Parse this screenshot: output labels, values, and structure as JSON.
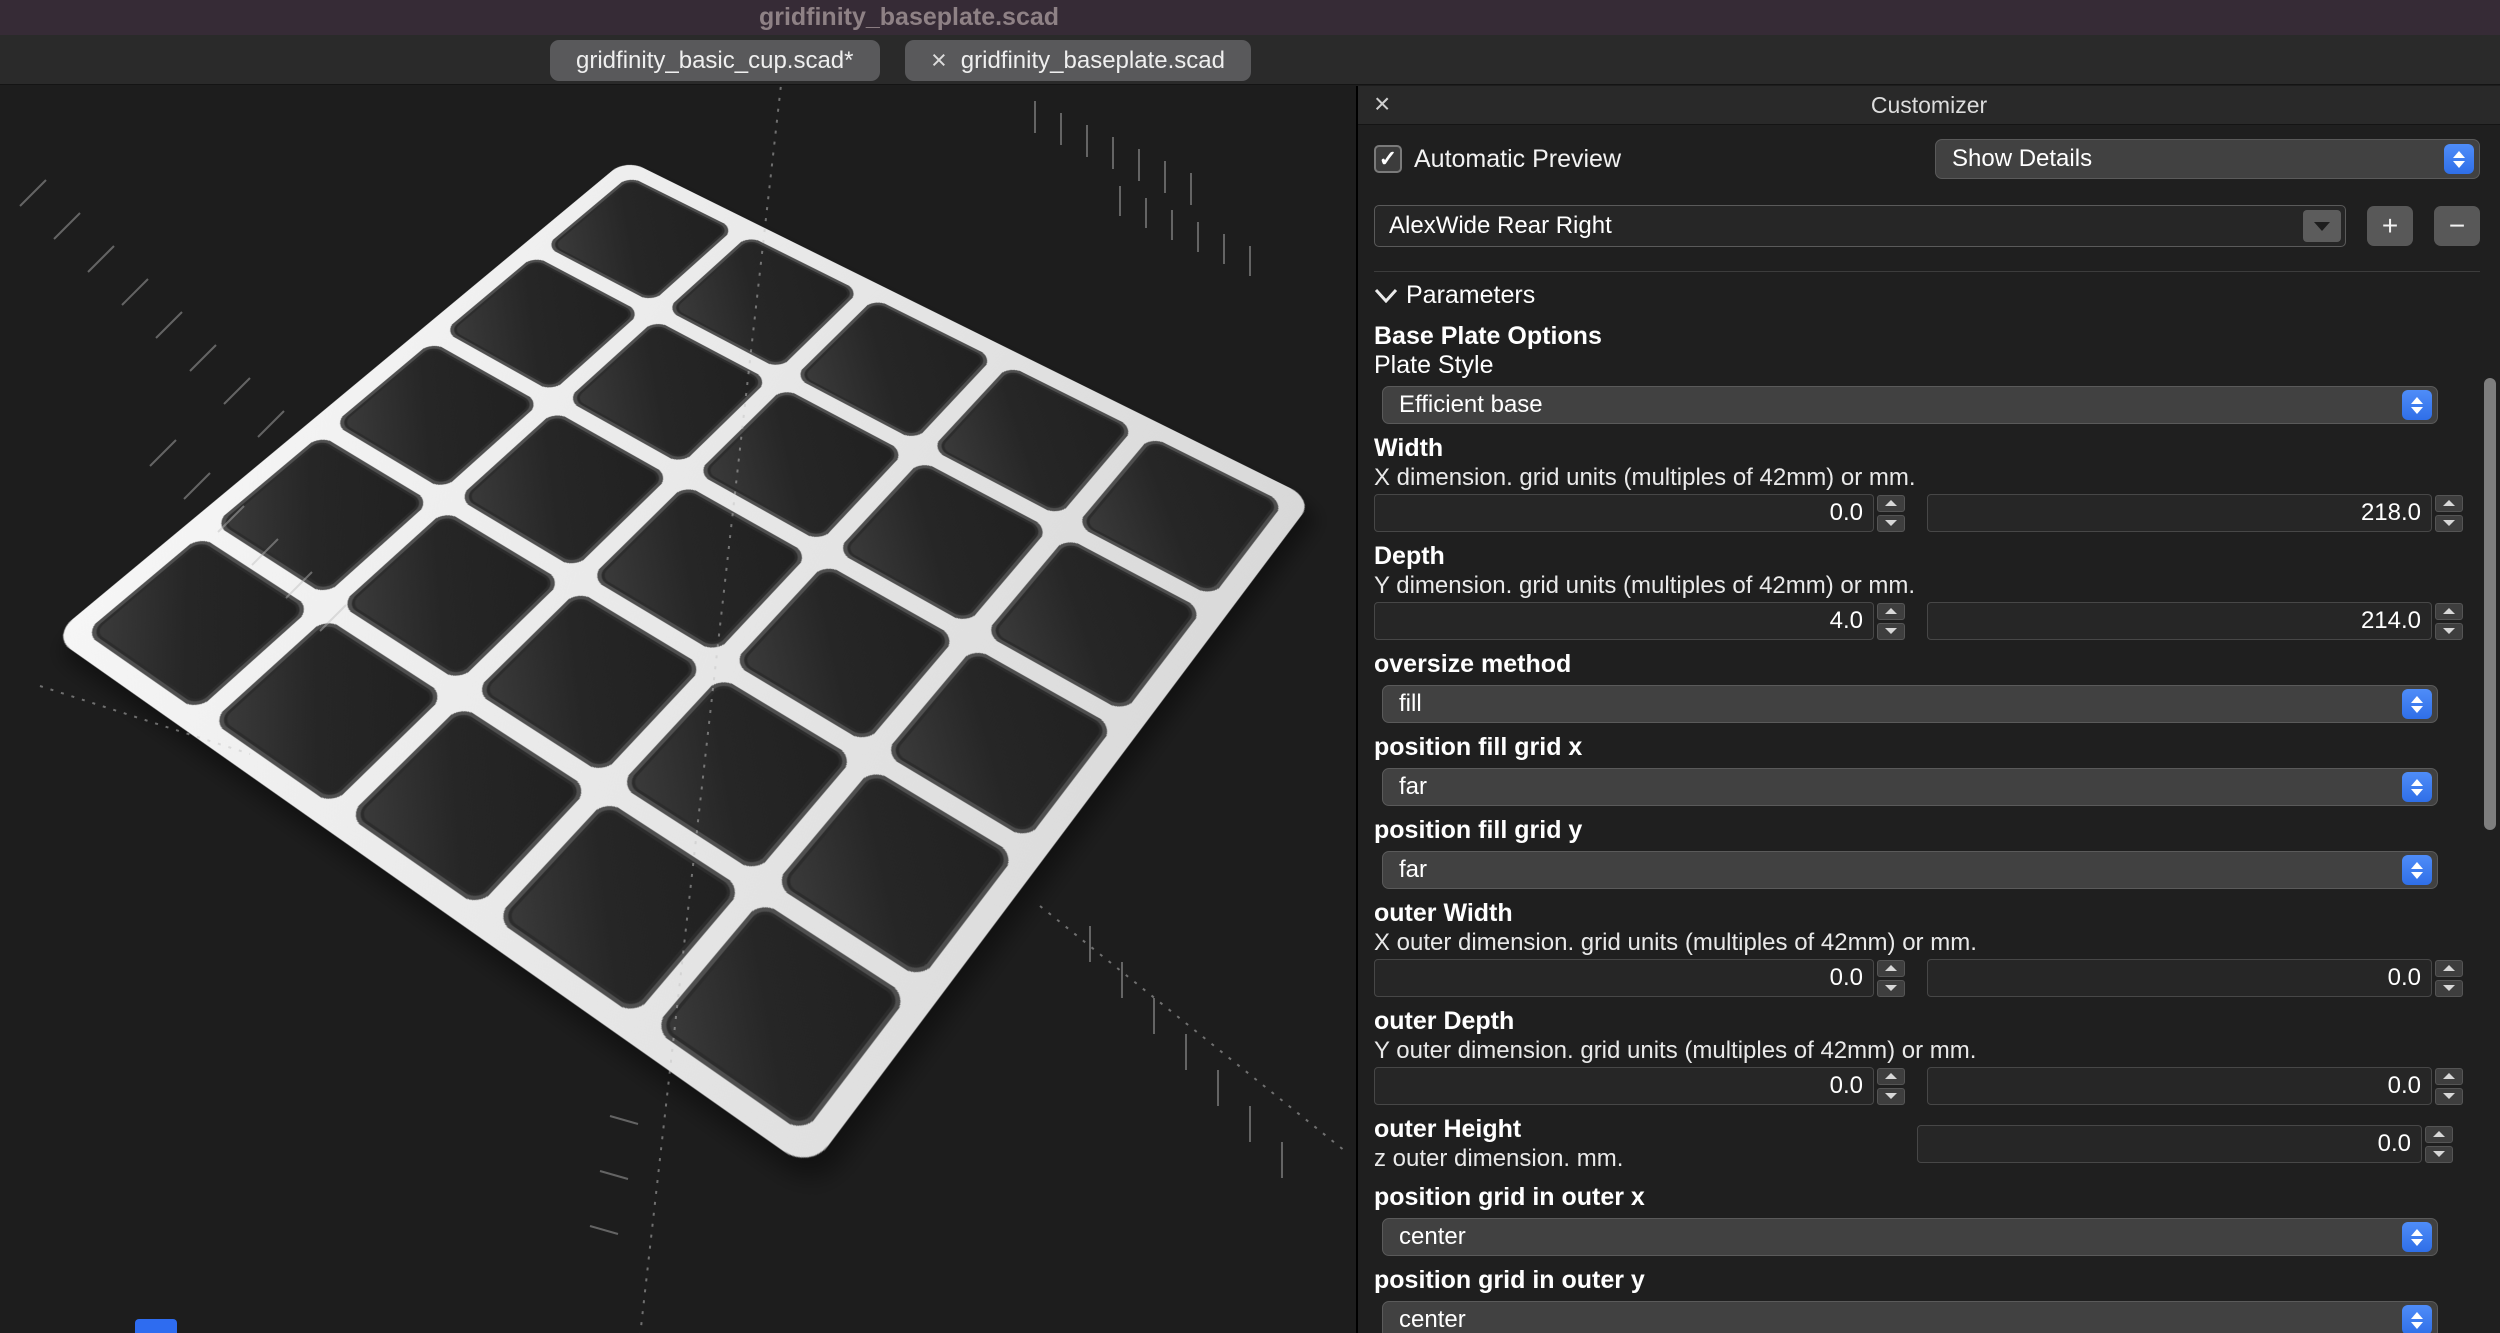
{
  "window": {
    "title": "gridfinity_baseplate.scad"
  },
  "tabs": {
    "items": [
      {
        "label": "gridfinity_basic_cup.scad*"
      },
      {
        "label": "gridfinity_baseplate.scad"
      }
    ]
  },
  "icons": {
    "close": "×",
    "check": "✓",
    "plus": "+",
    "minus": "−"
  },
  "customizer": {
    "title": "Customizer",
    "automatic_preview": "Automatic Preview",
    "details_select": "Show Details",
    "preset": "AlexWide Rear Right",
    "parameters": "Parameters",
    "params": [
      {
        "label": "Base Plate Options"
      },
      {
        "label": "Plate Style",
        "value": "Efficient base"
      },
      {
        "label": "Width",
        "desc": "X dimension. grid units (multiples of 42mm) or mm.",
        "value1": "0.0",
        "value2": "218.0"
      },
      {
        "label": "Depth",
        "desc": "Y dimension. grid units (multiples of 42mm) or mm.",
        "value1": "4.0",
        "value2": "214.0"
      },
      {
        "label": "oversize method",
        "value": "fill"
      },
      {
        "label": "position fill grid x",
        "value": "far"
      },
      {
        "label": "position fill grid y",
        "value": "far"
      },
      {
        "label": "outer Width",
        "desc": "X outer dimension. grid units (multiples of 42mm) or mm.",
        "value1": "0.0",
        "value2": "0.0"
      },
      {
        "label": "outer Depth",
        "desc": "Y outer dimension. grid units (multiples of 42mm) or mm.",
        "value1": "0.0",
        "value2": "0.0"
      },
      {
        "label": "outer Height",
        "desc": "z outer dimension. mm.",
        "value": "0.0"
      },
      {
        "label": "position grid in outer x",
        "value": "center"
      },
      {
        "label": "position grid in outer y",
        "value": "center"
      }
    ]
  }
}
